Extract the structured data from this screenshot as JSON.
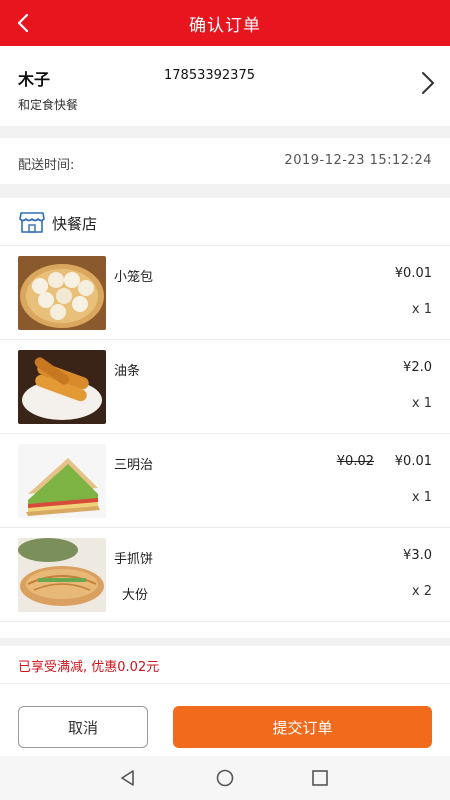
{
  "header": {
    "title": "确认订单",
    "back_icon": "chevron-left-icon",
    "bg_color": "#e8141e"
  },
  "address": {
    "name": "木子",
    "phone": "17853392375",
    "place": "和定食快餐"
  },
  "delivery": {
    "label": "配送时间:",
    "value": "2019-12-23  15:12:24"
  },
  "shop": {
    "name": "快餐店",
    "icon": "store-icon"
  },
  "items": [
    {
      "name": "小笼包",
      "price": "¥0.01",
      "qty": "x 1"
    },
    {
      "name": "油条",
      "price": "¥2.0",
      "qty": "x 1"
    },
    {
      "name": "三明治",
      "old_price": "¥0.02",
      "price": "¥0.01",
      "qty": "x 1"
    },
    {
      "name": "手抓饼",
      "spec": "大份",
      "price": "¥3.0",
      "qty": "x 2"
    }
  ],
  "promo": {
    "text": "已享受满减, 优惠0.02元",
    "color": "#d0141c"
  },
  "actions": {
    "cancel_label": "取消",
    "submit_label": "提交订单",
    "submit_color": "#f26b1d"
  },
  "system_nav": {
    "back": "triangle-back-icon",
    "home": "circle-home-icon",
    "recents": "square-recents-icon"
  }
}
